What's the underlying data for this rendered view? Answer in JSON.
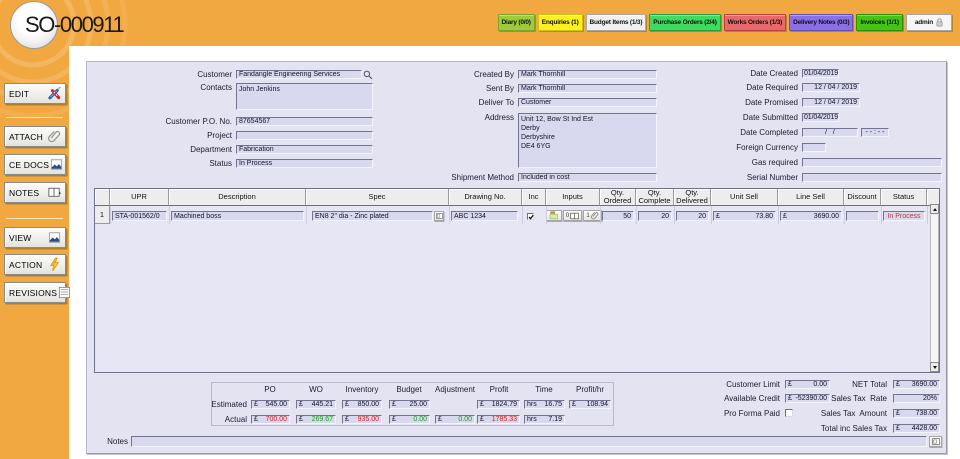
{
  "window": {
    "title": "SO-000911"
  },
  "colors": {
    "chrome_orange": "#F2A840",
    "panel_lavender": "#E3E3F2",
    "field_lavender": "#D8D8EE",
    "summary_negative": "#cc2424",
    "summary_positive": "#1e9e1e",
    "status_alert": "#c03a3a"
  },
  "toolbar": {
    "buttons": [
      {
        "label": "Diary (0/0)",
        "bg": "#9ECB3B",
        "border": "#7da32b"
      },
      {
        "label": "Enquiries (1)",
        "bg": "#FCF021",
        "border": "#cfc312"
      },
      {
        "label": "Budget Items (1/3)",
        "bg": "#F0F0F0",
        "border": "#a8a8a8"
      },
      {
        "label": "Purchase Orders (2/4)",
        "bg": "#3FDB5F",
        "border": "#2b9e45"
      },
      {
        "label": "Works Orders (1/3)",
        "bg": "#E9696B",
        "border": "#b34548"
      },
      {
        "label": "Delivery Notes (0/3)",
        "bg": "#8A6FE9",
        "border": "#6550b5"
      },
      {
        "label": "Invoices (1/1)",
        "bg": "#44C413",
        "border": "#2f8f0c"
      },
      {
        "label": "admin",
        "bg": "#F6F6F6",
        "border": "#a8a8a8"
      }
    ]
  },
  "sidebar": {
    "buttons": [
      {
        "label": "EDIT"
      },
      {
        "label": "ATTACH"
      },
      {
        "label": "CE DOCS"
      },
      {
        "label": "NOTES"
      },
      {
        "label": "VIEW"
      },
      {
        "label": "ACTION"
      },
      {
        "label": "REVISIONS"
      }
    ]
  },
  "form": {
    "customer": {
      "label": "Customer",
      "value": "Fandangle Engineering Services"
    },
    "contacts": {
      "label": "Contacts",
      "value": "John Jenkins"
    },
    "po": {
      "label": "Customer P.O. No.",
      "value": "87654567"
    },
    "project": {
      "label": "Project",
      "value": ""
    },
    "department": {
      "label": "Department",
      "value": "Fabrication"
    },
    "status": {
      "label": "Status",
      "value": "In Process"
    },
    "created_by": {
      "label": "Created By",
      "value": "Mark Thornhill"
    },
    "sent_by": {
      "label": "Sent By",
      "value": "Mark Thornhill"
    },
    "deliver_to": {
      "label": "Deliver To",
      "value": "Customer"
    },
    "address": {
      "label": "Address",
      "line1": "Unit 12, Bow St Ind Est",
      "line2": "Derby",
      "line3": "Derbyshire",
      "line4": "DE4 6YG"
    },
    "shipment": {
      "label": "Shipment Method",
      "value": "Included in cost"
    },
    "date_created": {
      "label": "Date Created",
      "value": "01/04/2019"
    },
    "date_required": {
      "label": "Date Required",
      "value": "12 / 04 / 2019"
    },
    "date_promised": {
      "label": "Date Promised",
      "value": "12 / 04 / 2019"
    },
    "date_submitted": {
      "label": "Date Submitted",
      "value": "01/04/2019"
    },
    "date_completed": {
      "label": "Date Completed",
      "value": "/   /",
      "time": "- - : - -"
    },
    "foreign_currency": {
      "label": "Foreign Currency",
      "value": ""
    },
    "gas_required": {
      "label": "Gas required",
      "value": ""
    },
    "serial_number": {
      "label": "Serial Number",
      "value": ""
    }
  },
  "table": {
    "columns": [
      "",
      "UPR",
      "Description",
      "Spec",
      "Drawing No.",
      "Inc",
      "Inputs",
      "Qty. Ordered",
      "Qty. Complete",
      "Qty. Delivered",
      "Unit Sell",
      "Line Sell",
      "Discount",
      "Status"
    ],
    "row": {
      "num": "1",
      "upr": "STA-001562/0",
      "description": "Machined boss",
      "spec": "EN8 2\" dia - Zinc plated",
      "drawing_no": "ABC 1234",
      "inputs_docs_count": "0",
      "inputs_attach_count": "1",
      "qty_ordered": "50",
      "qty_complete": "20",
      "qty_delivered": "20",
      "unit_sell": {
        "cur": "£",
        "val": "73.80"
      },
      "line_sell": {
        "cur": "£",
        "val": "3690.00"
      },
      "discount": "",
      "status": "In Process"
    }
  },
  "summary": {
    "headers": [
      "PO",
      "WO",
      "Inventory",
      "Budget",
      "Adjustment",
      "Profit",
      "Time",
      "Profit/hr"
    ],
    "estimated_label": "Estimated",
    "actual_label": "Actual",
    "estimated": {
      "po": {
        "cur": "£",
        "val": "545.00"
      },
      "wo": {
        "cur": "£",
        "val": "445.21"
      },
      "inventory": {
        "cur": "£",
        "val": "850.00"
      },
      "budget": {
        "cur": "£",
        "val": "25.00"
      },
      "profit": {
        "cur": "£",
        "val": "1824.79"
      },
      "time": {
        "cur": "hrs",
        "val": "16.75"
      },
      "profithr": {
        "cur": "£",
        "val": "108.94"
      }
    },
    "actual": {
      "po": {
        "cur": "£",
        "val": "700.00"
      },
      "wo": {
        "cur": "£",
        "val": "269.67"
      },
      "inventory": {
        "cur": "£",
        "val": "935.00"
      },
      "budget": {
        "cur": "£",
        "val": "0.00"
      },
      "adjustment": {
        "cur": "£",
        "val": "0.00"
      },
      "profit": {
        "cur": "£",
        "val": "1785.33"
      },
      "time": {
        "cur": "hrs",
        "val": "7.19"
      }
    }
  },
  "totals": {
    "customer_limit": {
      "label": "Customer Limit",
      "cur": "£",
      "val": "0.00"
    },
    "available_credit": {
      "label": "Available Credit",
      "cur": "£",
      "val": "-52390.00"
    },
    "pro_forma_paid": {
      "label": "Pro Forma Paid"
    },
    "net_total": {
      "label": "NET Total",
      "cur": "£",
      "val": "3690.00"
    },
    "sales_tax_rate": {
      "label": "Sales Tax  Rate",
      "val": "20%"
    },
    "sales_tax_amount": {
      "label": "Sales Tax  Amount",
      "cur": "£",
      "val": "738.00"
    },
    "total_inc": {
      "label": "Total inc Sales Tax",
      "cur": "£",
      "val": "4428.00"
    }
  },
  "notes": {
    "label": "Notes",
    "value": ""
  }
}
